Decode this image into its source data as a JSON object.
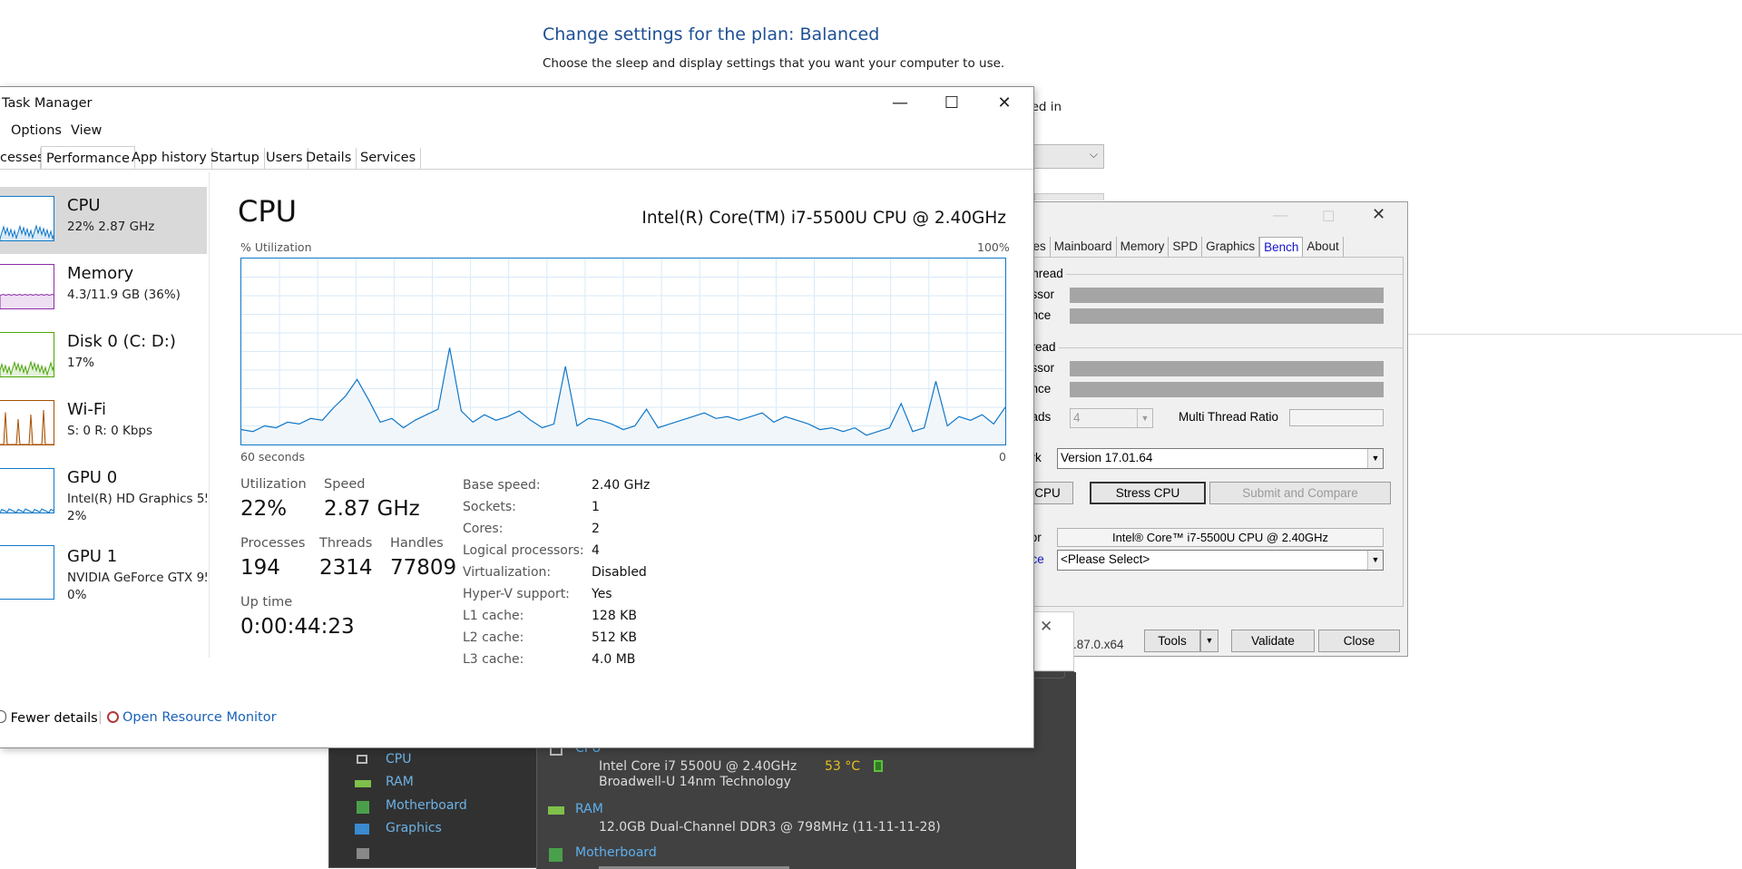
{
  "power_plan": {
    "title": "Change settings for the plan: Balanced",
    "subtitle": "Choose the sleep and display settings that you want your computer to use.",
    "column_fragment": "ged in"
  },
  "cpuz": {
    "tabs": [
      "hes",
      "Mainboard",
      "Memory",
      "SPD",
      "Graphics",
      "Bench",
      "About"
    ],
    "active_tab": "Bench",
    "single_thread_title": "Thread",
    "single_processor_label": "essor",
    "single_reference_label": "ence",
    "multi_thread_title": "hread",
    "multi_processor_label": "essor",
    "multi_reference_label": "ence",
    "threads_label": "eads",
    "threads_value": "4",
    "multi_ratio_label": "Multi Thread Ratio",
    "benchmark_label": "ark",
    "benchmark_version": "Version 17.01.64",
    "bench_cpu_btn": "CPU",
    "stress_cpu_btn": "Stress CPU",
    "submit_btn": "Submit and Compare",
    "processor_label": "sor",
    "processor_value": "Intel® Core™ i7-5500U CPU @ 2.40GHz",
    "reference_label": "nce",
    "reference_value": "<Please Select>",
    "version_text": ".87.0.x64",
    "tools_btn": "Tools",
    "validate_btn": "Validate",
    "close_btn": "Close"
  },
  "speccy": {
    "sidebar": [
      {
        "label": "CPU",
        "icon": "cpu-icon"
      },
      {
        "label": "RAM",
        "icon": "ram-icon"
      },
      {
        "label": "Motherboard",
        "icon": "motherboard-icon"
      },
      {
        "label": "Graphics",
        "icon": "graphics-icon"
      }
    ],
    "cpu_heading": "CPU",
    "cpu_line1": "Intel Core i7 5500U @ 2.40GHz",
    "cpu_temp": "53 °C",
    "cpu_line2": "Broadwell-U 14nm Technology",
    "ram_heading": "RAM",
    "ram_line": "12.0GB Dual-Channel DDR3 @ 798MHz (11-11-11-28)",
    "mb_heading": "Motherboard",
    "colors": {
      "bg": "#313131",
      "heading": "#5fb0ee",
      "temp": "#e8c020"
    }
  },
  "task_manager": {
    "title": "Task Manager",
    "menu": [
      "Options",
      "View"
    ],
    "tabs": [
      "cesses",
      "Performance",
      "App history",
      "Startup",
      "Users",
      "Details",
      "Services"
    ],
    "active_tab": "Performance",
    "resources": [
      {
        "name": "CPU",
        "sub1": "22%  2.87 GHz",
        "sub2": "",
        "color": "#1178c8"
      },
      {
        "name": "Memory",
        "sub1": "4.3/11.9 GB (36%)",
        "sub2": "",
        "color": "#8b2ea8"
      },
      {
        "name": "Disk 0 (C: D:)",
        "sub1": "17%",
        "sub2": "",
        "color": "#4da60c"
      },
      {
        "name": "Wi-Fi",
        "sub1": "S: 0  R: 0 Kbps",
        "sub2": "",
        "color": "#a74f01"
      },
      {
        "name": "GPU 0",
        "sub1": "Intel(R) HD Graphics 55",
        "sub2": "2%",
        "color": "#1178c8"
      },
      {
        "name": "GPU 1",
        "sub1": "NVIDIA GeForce GTX 95",
        "sub2": "0%",
        "color": "#1178c8"
      }
    ],
    "heading": "CPU",
    "model": "Intel(R) Core(TM) i7-5500U CPU @ 2.40GHz",
    "y_label": "% Utilization",
    "y_max_label": "100%",
    "x_left_label": "60 seconds",
    "x_right_label": "0",
    "utilization_series": [
      8,
      7,
      10,
      9,
      12,
      11,
      14,
      13,
      20,
      26,
      35,
      24,
      12,
      14,
      9,
      13,
      16,
      19,
      52,
      18,
      12,
      16,
      13,
      15,
      18,
      13,
      9,
      11,
      42,
      10,
      14,
      13,
      11,
      8,
      10,
      19,
      9,
      11,
      13,
      15,
      17,
      14,
      15,
      13,
      15,
      17,
      12,
      15,
      13,
      11,
      8,
      9,
      7,
      9,
      5,
      7,
      9,
      22,
      7,
      9,
      34,
      10,
      15,
      13,
      16,
      11,
      20
    ],
    "stats": {
      "utilization_label": "Utilization",
      "utilization": "22%",
      "speed_label": "Speed",
      "speed": "2.87 GHz",
      "processes_label": "Processes",
      "processes": "194",
      "threads_label": "Threads",
      "threads": "2314",
      "handles_label": "Handles",
      "handles": "77809",
      "uptime_label": "Up time",
      "uptime": "0:00:44:23"
    },
    "properties": [
      {
        "k": "Base speed:",
        "v": "2.40 GHz"
      },
      {
        "k": "Sockets:",
        "v": "1"
      },
      {
        "k": "Cores:",
        "v": "2"
      },
      {
        "k": "Logical processors:",
        "v": "4"
      },
      {
        "k": "Virtualization:",
        "v": "Disabled"
      },
      {
        "k": "Hyper-V support:",
        "v": "Yes"
      },
      {
        "k": "L1 cache:",
        "v": "128 KB"
      },
      {
        "k": "L2 cache:",
        "v": "512 KB"
      },
      {
        "k": "L3 cache:",
        "v": "4.0 MB"
      }
    ],
    "fewer_details": "Fewer details",
    "open_resource_monitor": "Open Resource Monitor"
  }
}
